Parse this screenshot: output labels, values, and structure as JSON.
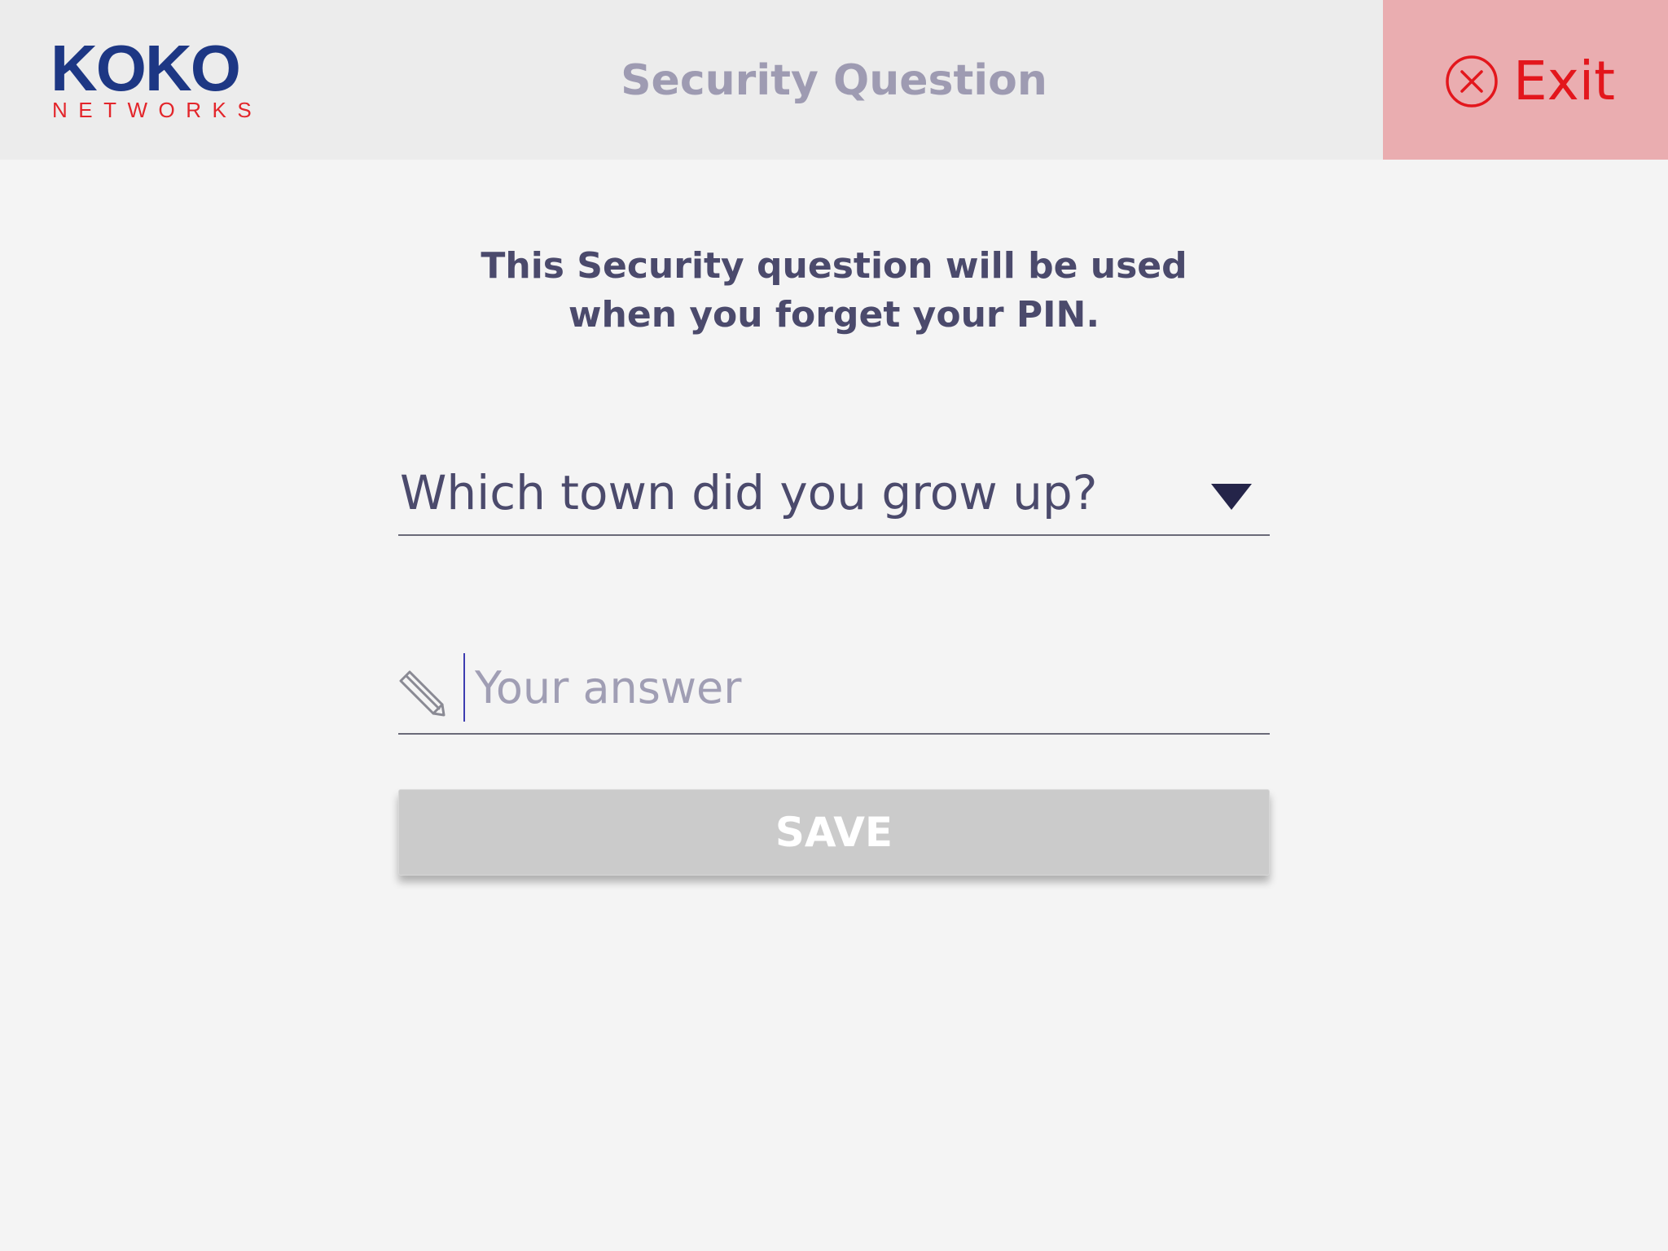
{
  "header": {
    "logo": {
      "brand": "KOKO",
      "sub": "NETWORKS"
    },
    "title": "Security Question",
    "exit_label": "Exit"
  },
  "colors": {
    "brand_blue": "#1d3784",
    "brand_red": "#e3262b",
    "exit_bg": "#eaadb0",
    "exit_text": "#e3161c",
    "save_disabled_bg": "#cbcbcb"
  },
  "main": {
    "instructions": {
      "line1": "This Security question will be used",
      "line2": "when you forget your PIN."
    },
    "question_select": {
      "selected": "Which town did you grow up?"
    },
    "answer_field": {
      "value": "",
      "placeholder": "Your answer"
    },
    "save_label": "SAVE"
  },
  "icons": {
    "exit": "close-circle-icon",
    "dropdown": "triangle-down-icon",
    "answer": "pencil-icon"
  }
}
